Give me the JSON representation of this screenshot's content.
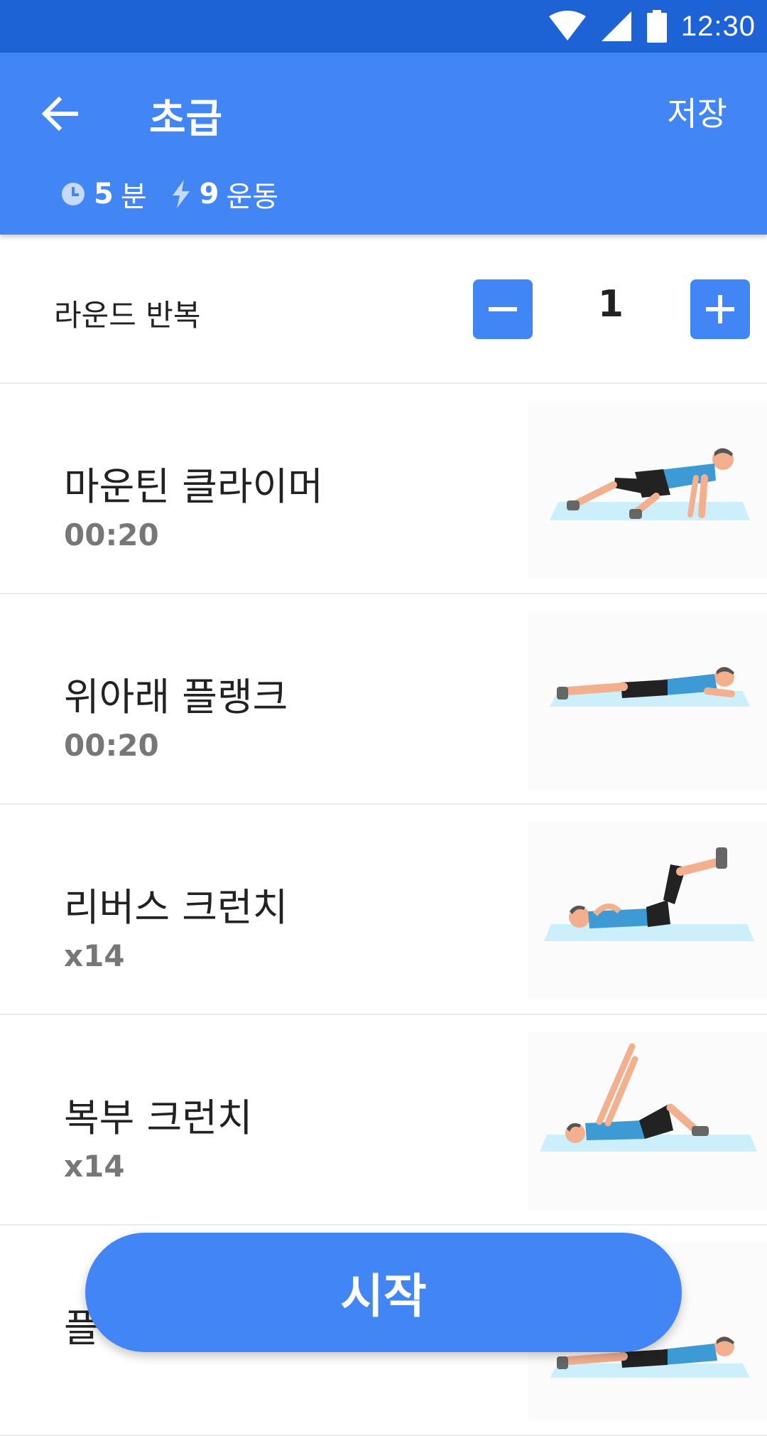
{
  "status_bar": {
    "time": "12:30"
  },
  "header": {
    "title": "초급",
    "save_label": "저장",
    "duration_value": "5",
    "duration_unit": "분",
    "exercise_count_value": "9",
    "exercise_count_unit": "운동"
  },
  "rounds": {
    "label": "라운드 반복",
    "value": "1"
  },
  "exercises": [
    {
      "name": "마운틴 클라이머",
      "detail": "00:20",
      "pose": "mountain-climber"
    },
    {
      "name": "위아래 플랭크",
      "detail": "00:20",
      "pose": "plank"
    },
    {
      "name": "리버스 크런치",
      "detail": "x14",
      "pose": "reverse-crunch"
    },
    {
      "name": "복부 크런치",
      "detail": "x14",
      "pose": "abdominal-crunch"
    },
    {
      "name": "플",
      "detail": "",
      "pose": "plank"
    }
  ],
  "start_label": "시작",
  "colors": {
    "primary": "#4285f4",
    "status_bar": "#1e63d6",
    "mat": "#cdeefb"
  }
}
